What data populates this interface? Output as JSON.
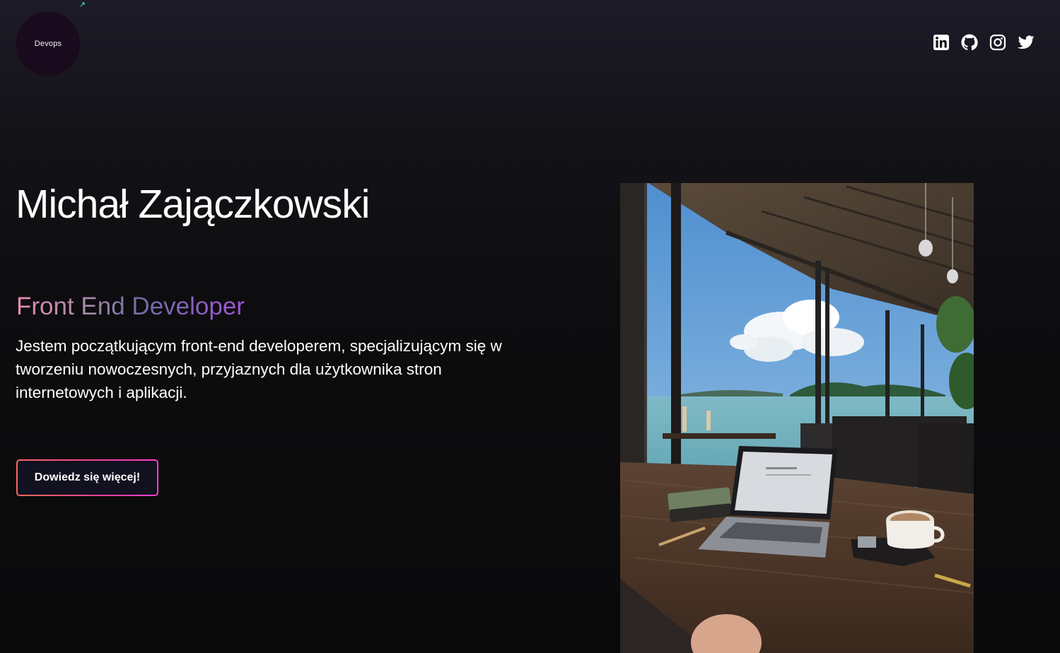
{
  "header": {
    "logo_text": "Devops",
    "logo_mark_color": "#2fd9a3",
    "social_links": [
      {
        "name": "linkedin",
        "icon": "linkedin-icon"
      },
      {
        "name": "github",
        "icon": "github-icon"
      },
      {
        "name": "instagram",
        "icon": "instagram-icon"
      },
      {
        "name": "twitter",
        "icon": "twitter-icon"
      }
    ]
  },
  "hero": {
    "name": "Michał Zajączkowski",
    "role": "Front End Developer",
    "bio": "Jestem początkującym front-end developerem, specjalizującym się w tworzeniu nowoczesnych, przyjaznych dla użytkownika stron internetowych i aplikacji.",
    "cta_label": "Dowiedz się więcej!",
    "photo_description_icon": "photo-cafe-laptop-sea"
  },
  "colors": {
    "background": "#0a0a0b",
    "role_gradient": [
      "#e58cb6",
      "#6d6ca5",
      "#a054d6"
    ],
    "cta_border_gradient": [
      "#f86a5a",
      "#ee3f9c",
      "#ff3ed0"
    ],
    "cta_background": "#111120"
  }
}
